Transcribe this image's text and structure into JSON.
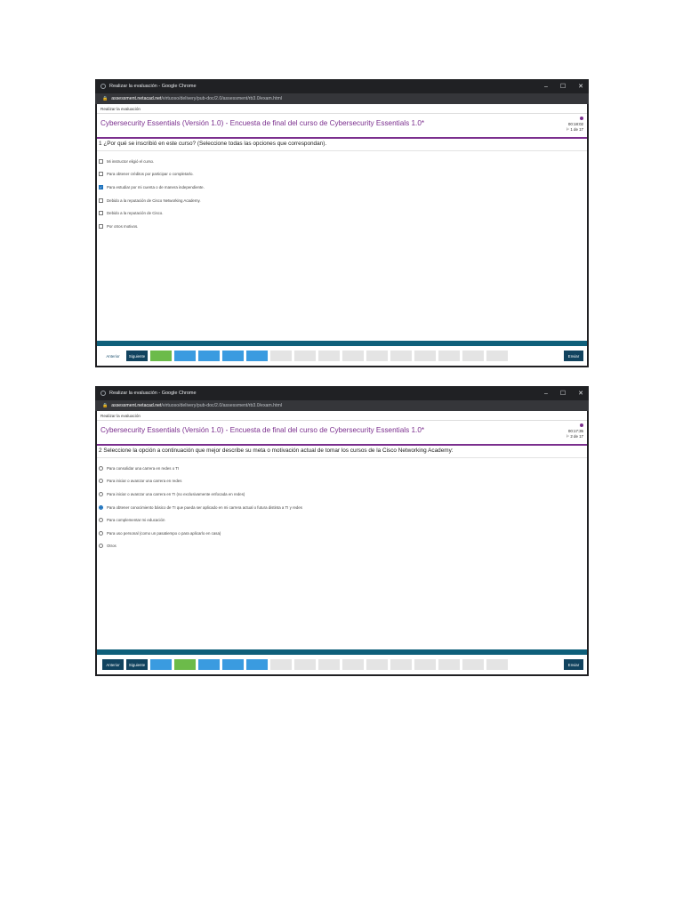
{
  "screens": [
    {
      "window_title": "Realizar la evaluación - Google Chrome",
      "url_host": "assessment.netacad.net",
      "url_path": "/virtuoso/delivery/pub-doc/2.0/assessment/rb3.0/exam.html",
      "breadcrumb": "Realizar la evaluación",
      "exam_title": "Cybersecurity Essentials (Versión 1.0) - Encuesta de final del curso de Cybersecurity Essentials 1.0*",
      "timer": "00:18:02",
      "progress": "1 de 17",
      "question": "1  ¿Por qué se inscribió en este curso? (Seleccione todas las opciones que correspondan).",
      "option_kind": "checkbox",
      "options": [
        {
          "label": "Mi instructor eligió el curso.",
          "checked": false
        },
        {
          "label": "Para obtener créditos por participar o completarlo.",
          "checked": false
        },
        {
          "label": "Para estudiar por mi cuenta o de manera independiente.",
          "checked": true
        },
        {
          "label": "Debido a la reputación de Cisco Networking Academy.",
          "checked": false
        },
        {
          "label": "Debido a la reputación de Cisco.",
          "checked": false
        },
        {
          "label": "Por otros motivos.",
          "checked": false
        }
      ],
      "nav": {
        "prev": "Anterior",
        "next": "Siguiente",
        "send": "Enviar"
      },
      "question_squares": [
        "green",
        "blue",
        "blue",
        "blue",
        "blue",
        "gray",
        "gray",
        "gray",
        "gray",
        "gray",
        "gray",
        "gray",
        "gray",
        "gray",
        "gray",
        "gray",
        "gray"
      ]
    },
    {
      "window_title": "Realizar la evaluación - Google Chrome",
      "url_host": "assessment.netacad.net",
      "url_path": "/virtuoso/delivery/pub-doc/2.0/assessment/rb3.0/exam.html",
      "breadcrumb": "Realizar la evaluación",
      "exam_title": "Cybersecurity Essentials (Versión 1.0) - Encuesta de final del curso de Cybersecurity Essentials 1.0*",
      "timer": "00:17:35",
      "progress": "2 de 17",
      "question": "2  Seleccione la opción a continuación que mejor describe su meta o motivación actual de tomar los cursos de la Cisco Networking Academy:",
      "option_kind": "radio",
      "options": [
        {
          "label": "Para consolidar una carrera en redes o TI",
          "checked": false
        },
        {
          "label": "Para iniciar o avanzar una carrera en redes",
          "checked": false
        },
        {
          "label": "Para iniciar o avanzar una carrera en TI (no exclusivamente enfocada en redes)",
          "checked": false
        },
        {
          "label": "Para obtener conocimiento básico de TI que pueda ser aplicado en mi carrera actual o futura distinta a TI y redes",
          "checked": true
        },
        {
          "label": "Para complementar mi educación",
          "checked": false
        },
        {
          "label": "Para uso personal (como un pasatiempo o para aplicarlo en casa)",
          "checked": false
        },
        {
          "label": "Otros",
          "checked": false
        }
      ],
      "nav": {
        "prev": "Anterior",
        "next": "Siguiente",
        "send": "Enviar"
      },
      "question_squares": [
        "blue",
        "green",
        "blue",
        "blue",
        "blue",
        "gray",
        "gray",
        "gray",
        "gray",
        "gray",
        "gray",
        "gray",
        "gray",
        "gray",
        "gray",
        "gray",
        "gray"
      ]
    }
  ],
  "colors": {
    "accent": "#7b2f8e",
    "nav_dark": "#11435f",
    "answered": "#3a9be0",
    "current": "#6cbb4a",
    "unanswered": "#e4e4e4",
    "strip": "#0e5f7a"
  }
}
